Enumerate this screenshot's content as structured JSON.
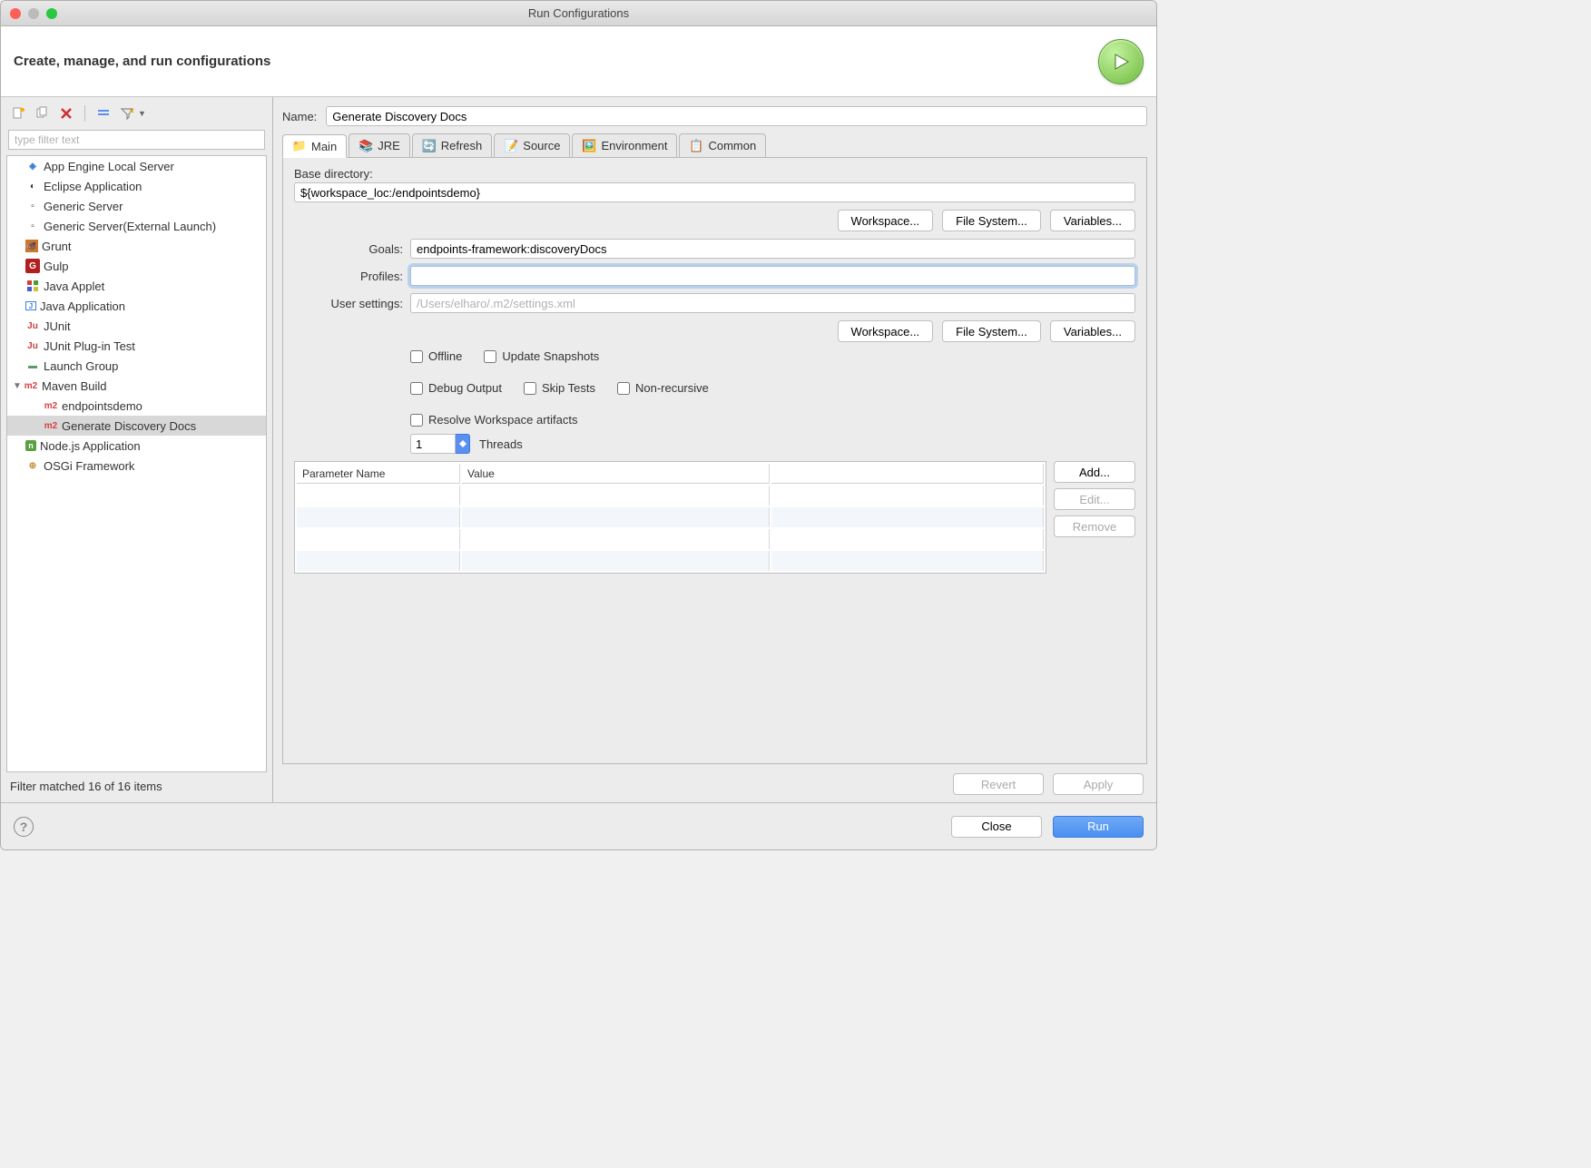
{
  "window": {
    "title": "Run Configurations"
  },
  "header": {
    "title": "Create, manage, and run configurations"
  },
  "sidebar": {
    "filter_placeholder": "type filter text",
    "items": [
      {
        "label": "App Engine Local Server"
      },
      {
        "label": "Eclipse Application"
      },
      {
        "label": "Generic Server"
      },
      {
        "label": "Generic Server(External Launch)"
      },
      {
        "label": "Grunt"
      },
      {
        "label": "Gulp"
      },
      {
        "label": "Java Applet"
      },
      {
        "label": "Java Application"
      },
      {
        "label": "JUnit"
      },
      {
        "label": "JUnit Plug-in Test"
      },
      {
        "label": "Launch Group"
      },
      {
        "label": "Maven Build",
        "expanded": true,
        "children": [
          {
            "label": "endpointsdemo"
          },
          {
            "label": "Generate Discovery Docs",
            "selected": true
          }
        ]
      },
      {
        "label": "Node.js Application"
      },
      {
        "label": "OSGi Framework"
      }
    ],
    "status": "Filter matched 16 of 16 items"
  },
  "detail": {
    "name_label": "Name:",
    "name_value": "Generate Discovery Docs",
    "tabs": [
      {
        "label": "Main",
        "active": true
      },
      {
        "label": "JRE"
      },
      {
        "label": "Refresh"
      },
      {
        "label": "Source"
      },
      {
        "label": "Environment"
      },
      {
        "label": "Common"
      }
    ],
    "basedir_label": "Base directory:",
    "basedir_value": "${workspace_loc:/endpointsdemo}",
    "btn_workspace": "Workspace...",
    "btn_filesystem": "File System...",
    "btn_variables": "Variables...",
    "goals_label": "Goals:",
    "goals_value": "endpoints-framework:discoveryDocs",
    "profiles_label": "Profiles:",
    "profiles_value": "",
    "usersettings_label": "User settings:",
    "usersettings_placeholder": "/Users/elharo/.m2/settings.xml",
    "usersettings_value": "",
    "checks": {
      "offline": "Offline",
      "update_snapshots": "Update Snapshots",
      "debug_output": "Debug Output",
      "skip_tests": "Skip Tests",
      "non_recursive": "Non-recursive",
      "resolve_workspace": "Resolve Workspace artifacts"
    },
    "threads": {
      "value": "1",
      "label": "Threads"
    },
    "param_table": {
      "col_name": "Parameter Name",
      "col_value": "Value"
    },
    "btn_add": "Add...",
    "btn_edit": "Edit...",
    "btn_remove": "Remove",
    "btn_revert": "Revert",
    "btn_apply": "Apply"
  },
  "footer": {
    "close": "Close",
    "run": "Run"
  }
}
